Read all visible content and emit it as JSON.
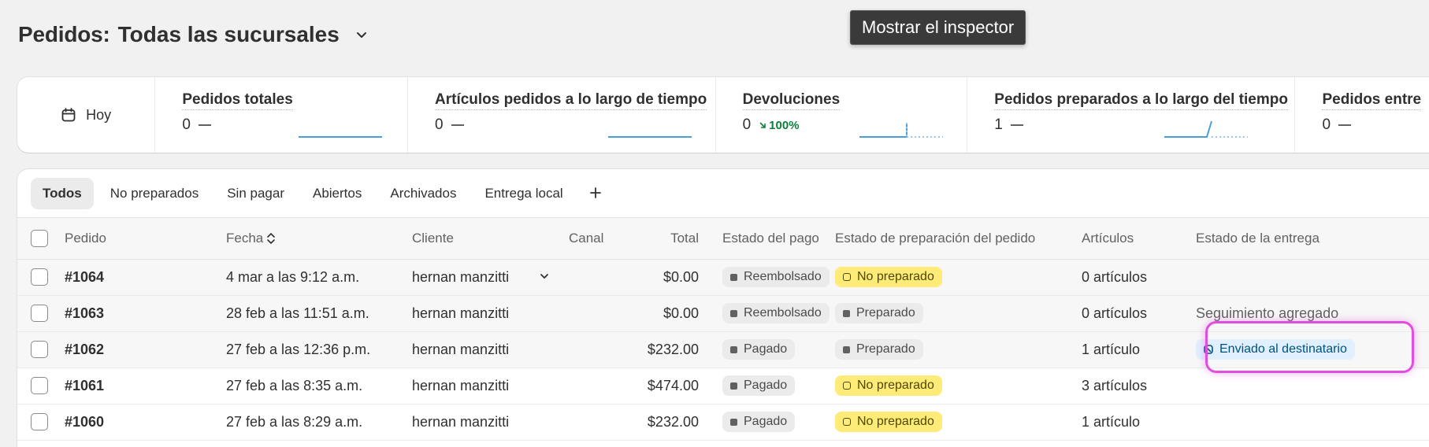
{
  "header": {
    "title": "Pedidos:",
    "location": "Todas las sucursales"
  },
  "tooltip": "Mostrar el inspector",
  "metrics": {
    "date_label": "Hoy",
    "items": [
      {
        "label": "Pedidos totales",
        "value": "0"
      },
      {
        "label": "Artículos pedidos a lo largo de tiempo",
        "value": "0"
      },
      {
        "label": "Devoluciones",
        "value": "0",
        "change": "100%"
      },
      {
        "label": "Pedidos preparados a lo largo del tiempo",
        "value": "1"
      },
      {
        "label": "Pedidos entre",
        "value": "0"
      }
    ]
  },
  "tabs": [
    "Todos",
    "No preparados",
    "Sin pagar",
    "Abiertos",
    "Archivados",
    "Entrega local"
  ],
  "columns": {
    "order": "Pedido",
    "date": "Fecha",
    "customer": "Cliente",
    "channel": "Canal",
    "total": "Total",
    "payment": "Estado del pago",
    "fulfillment": "Estado de preparación del pedido",
    "items": "Artículos",
    "delivery": "Estado de la entrega"
  },
  "rows": [
    {
      "order": "#1064",
      "date": "4 mar a las 9:12 a.m.",
      "customer": "hernan manzitti",
      "total": "$0.00",
      "payment": "Reembolsado",
      "fulfillment": "No preparado",
      "items": "0 artículos",
      "delivery": ""
    },
    {
      "order": "#1063",
      "date": "28 feb a las 11:51 a.m.",
      "customer": "hernan manzitti",
      "total": "$0.00",
      "payment": "Reembolsado",
      "fulfillment": "Preparado",
      "items": "0 artículos",
      "delivery": "Seguimiento agregado"
    },
    {
      "order": "#1062",
      "date": "27 feb a las 12:36 p.m.",
      "customer": "hernan manzitti",
      "total": "$232.00",
      "payment": "Pagado",
      "fulfillment": "Preparado",
      "items": "1 artículo",
      "delivery": "Enviado al destinatario"
    },
    {
      "order": "#1061",
      "date": "27 feb a las 8:35 a.m.",
      "customer": "hernan manzitti",
      "total": "$474.00",
      "payment": "Pagado",
      "fulfillment": "No preparado",
      "items": "3 artículos",
      "delivery": ""
    },
    {
      "order": "#1060",
      "date": "27 feb a las 8:29 a.m.",
      "customer": "hernan manzitti",
      "total": "$232.00",
      "payment": "Pagado",
      "fulfillment": "No preparado",
      "items": "1 artículo",
      "delivery": ""
    }
  ],
  "colors": {
    "yellow_badge": "#ffeb78",
    "blue_badge": "#e0f0ff",
    "highlight": "#e04ee0",
    "sparkline": "#4a9fd8"
  }
}
